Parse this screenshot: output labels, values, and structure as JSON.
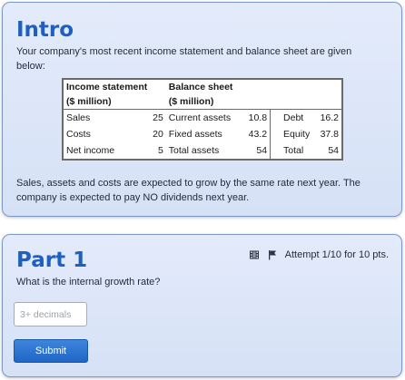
{
  "intro": {
    "title": "Intro",
    "description": "Your company's most recent income statement and balance sheet are given below:",
    "income_statement": {
      "header_line1": "Income statement",
      "header_line2": "($ million)",
      "rows": [
        {
          "label": "Sales",
          "value": "25"
        },
        {
          "label": "Costs",
          "value": "20"
        },
        {
          "label": "Net income",
          "value": "5"
        }
      ]
    },
    "balance_sheet": {
      "header_line1": "Balance sheet",
      "header_line2": "($ million)",
      "rows": [
        {
          "asset_label": "Current assets",
          "asset_value": "10.8",
          "liab_label": "Debt",
          "liab_value": "16.2"
        },
        {
          "asset_label": "Fixed assets",
          "asset_value": "43.2",
          "liab_label": "Equity",
          "liab_value": "37.8"
        },
        {
          "asset_label": "Total assets",
          "asset_value": "54",
          "liab_label": "Total",
          "liab_value": "54"
        }
      ]
    },
    "footnote": "Sales, assets and costs are expected to grow by the same rate next year. The company is expected to pay NO dividends next year."
  },
  "part": {
    "title": "Part 1",
    "attempt_text": "Attempt 1/10 for 10 pts.",
    "question": "What is the internal growth rate?",
    "answer": {
      "value": "",
      "placeholder": "3+ decimals"
    },
    "submit_label": "Submit"
  },
  "icons": {
    "video": "film-icon",
    "report": "flag-icon"
  },
  "colors": {
    "heading": "#1f5fbf",
    "card_border": "#7d97c4",
    "card_bg": "#dde6f8",
    "button": "#2a74d0"
  }
}
